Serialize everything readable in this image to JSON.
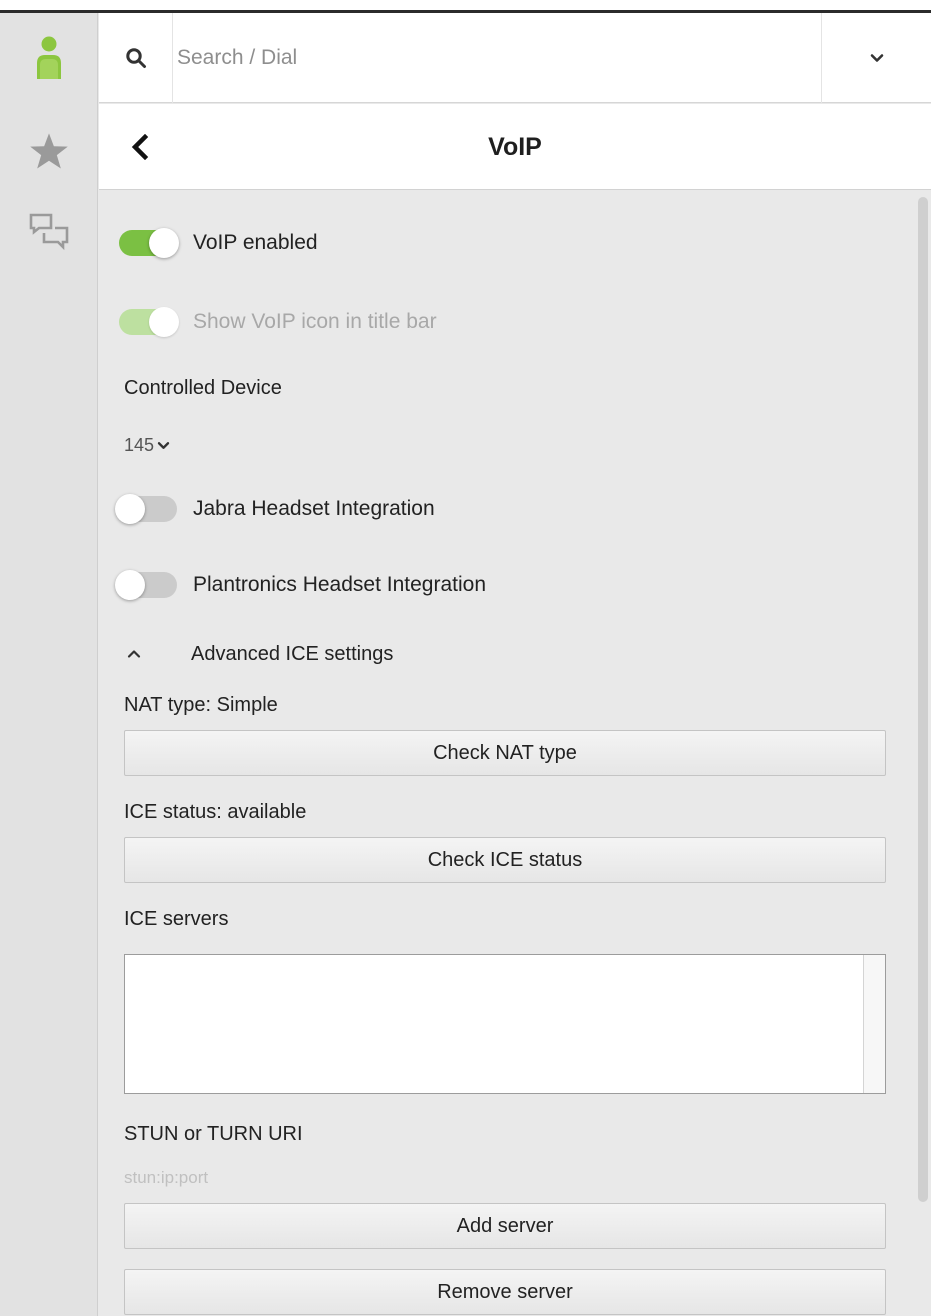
{
  "sidebar": {
    "items": [
      {
        "icon": "user-presence-icon",
        "color": "#8cc63f"
      },
      {
        "icon": "star-icon",
        "color": "#9a9a9a"
      },
      {
        "icon": "chat-bubbles-icon",
        "color": "#9a9a9a"
      }
    ]
  },
  "search": {
    "placeholder": "Search / Dial",
    "value": ""
  },
  "header": {
    "title": "VoIP"
  },
  "settings": {
    "voip_enabled": {
      "label": "VoIP enabled",
      "checked": true,
      "disabled": false
    },
    "show_voip_icon": {
      "label": "Show VoIP icon in title bar",
      "checked": true,
      "disabled": true
    },
    "controlled_device": {
      "label": "Controlled Device",
      "value": "145"
    },
    "jabra": {
      "label": "Jabra Headset Integration",
      "checked": false
    },
    "plantronics": {
      "label": "Plantronics Headset Integration",
      "checked": false
    },
    "advanced": {
      "label": "Advanced ICE settings",
      "expanded": true,
      "nat_type": "NAT type: Simple",
      "check_nat_button": "Check NAT type",
      "ice_status": "ICE status: available",
      "check_ice_button": "Check ICE status",
      "ice_servers_label": "ICE servers",
      "ice_servers": [],
      "uri_label": "STUN or TURN URI",
      "uri_placeholder": "stun:ip:port",
      "add_server_button": "Add server",
      "remove_server_button": "Remove server"
    }
  },
  "colors": {
    "accent": "#7bc043",
    "accent_disabled": "#bde0a0",
    "toggle_off": "#cbcbcb"
  }
}
